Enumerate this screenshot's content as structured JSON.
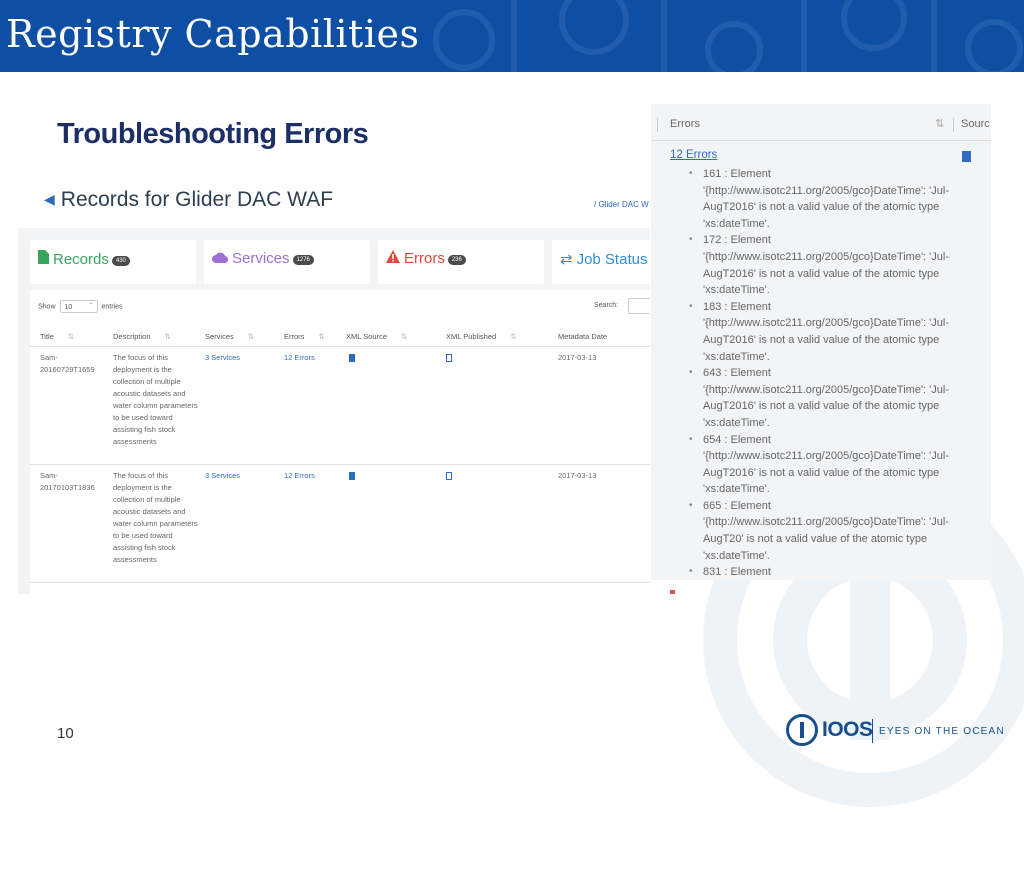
{
  "slide": {
    "title": "Registry Capabilities",
    "subtitle": "Troubleshooting Errors",
    "page_number": "10"
  },
  "records_view": {
    "heading": "Records for Glider DAC WAF",
    "breadcrumb": "/ Glider DAC W",
    "cards": [
      {
        "label": "Records",
        "count": "430",
        "color": "#3aa35c",
        "icon": "file-icon"
      },
      {
        "label": "Services",
        "count": "1276",
        "color": "#a06fd6",
        "icon": "cloud-icon"
      },
      {
        "label": "Errors",
        "count": "236",
        "color": "#e2473b",
        "icon": "warning-icon"
      },
      {
        "label": "Job Status",
        "count": "",
        "color": "#2f8fdc",
        "icon": "exchange-icon"
      }
    ],
    "show_label": "Show",
    "show_value": "10",
    "entries_label": "entries",
    "search_label": "Search:",
    "columns": [
      "Title",
      "Description",
      "Services",
      "Errors",
      "XML Source",
      "XML Published",
      "Metadata Date"
    ],
    "rows": [
      {
        "title": "Sam-20160729T1659",
        "description": "The focus of this deployment is the collection of multiple acoustic datasets and water column parameters to be used toward assisting fish stock assessments",
        "services": "3 Services",
        "errors": "12 Errors",
        "date": "2017-03-13"
      },
      {
        "title": "Sam-20170103T1836",
        "description": "The focus of this deployment is the collection of multiple acoustic datasets and water column parameters to be used toward assisting fish stock assessments",
        "services": "3 Services",
        "errors": "12 Errors",
        "date": "2017-03-13"
      }
    ]
  },
  "errors_view": {
    "column_label": "Errors",
    "source_label": "Sourc",
    "error_count_link": "12 Errors",
    "items": [
      "161 : Element '{http://www.isotc211.org/2005/gco}DateTime': 'Jul-AugT2016' is not a valid value of the atomic type 'xs:dateTime'.",
      "172 : Element '{http://www.isotc211.org/2005/gco}DateTime': 'Jul-AugT2016' is not a valid value of the atomic type 'xs:dateTime'.",
      "183 : Element '{http://www.isotc211.org/2005/gco}DateTime': 'Jul-AugT2016' is not a valid value of the atomic type 'xs:dateTime'.",
      "643 : Element '{http://www.isotc211.org/2005/gco}DateTime': 'Jul-AugT2016' is not a valid value of the atomic type 'xs:dateTime'.",
      "654 : Element '{http://www.isotc211.org/2005/gco}DateTime': 'Jul-AugT2016' is not a valid value of the atomic type 'xs:dateTime'.",
      "665 : Element '{http://www.isotc211.org/2005/gco}DateTime': 'Jul-AugT20' is not a valid value of the atomic type 'xs:dateTime'.",
      "831 : Element"
    ]
  },
  "footer": {
    "logo_name": "IOOS",
    "logo_tagline": "EYES ON THE OCEAN"
  },
  "colors": {
    "banner": "#0f4fa3",
    "title_dark": "#1c2e66",
    "link": "#2f6bbf"
  }
}
